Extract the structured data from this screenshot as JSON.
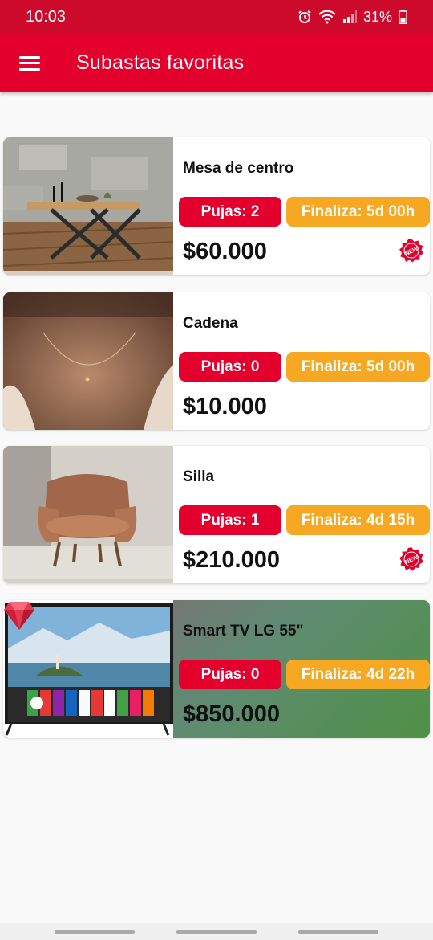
{
  "status": {
    "time": "10:03",
    "battery": "31%",
    "icons": [
      "alarm-icon",
      "wifi-icon",
      "signal-icon",
      "battery-icon"
    ]
  },
  "appbar": {
    "title": "Subastas favoritas",
    "menu_icon": "hamburger-menu-icon"
  },
  "colors": {
    "primary": "#e3002d",
    "status_bar": "#cd0a2c",
    "bids_chip": "#e3002d",
    "ends_chip": "#f7a823"
  },
  "auctions": [
    {
      "title": "Mesa de centro",
      "bids": "Pujas: 2",
      "ends": "Finaliza: 5d 00h",
      "price": "$60.000",
      "badge": "NEW",
      "image": "coffee-table-photo"
    },
    {
      "title": "Cadena",
      "bids": "Pujas: 0",
      "ends": "Finaliza: 5d 00h",
      "price": "$10.000",
      "image": "necklace-photo"
    },
    {
      "title": "Silla",
      "bids": "Pujas: 1",
      "ends": "Finaliza: 4d 15h",
      "price": "$210.000",
      "badge": "NEW",
      "image": "armchair-photo"
    },
    {
      "title": "Smart TV LG 55\"",
      "bids": "Pujas: 0",
      "ends": "Finaliza: 4d 22h",
      "price": "$850.000",
      "featured": true,
      "featured_icon": "ruby-gem-icon",
      "image": "smart-tv-photo"
    }
  ]
}
